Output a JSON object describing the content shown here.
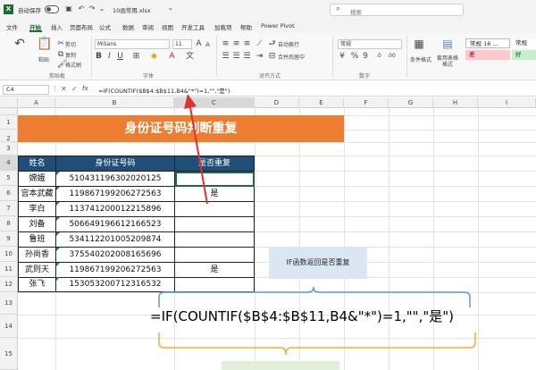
{
  "titlebar": {
    "autosave_label": "自动保存",
    "toggle_state": "关",
    "filename": "10函常用.xlsx",
    "search_placeholder": "搜索"
  },
  "menu": [
    "文件",
    "开始",
    "插入",
    "页面布局",
    "公式",
    "数据",
    "审阅",
    "视图",
    "开发工具",
    "加载项",
    "帮助",
    "Power Pivot"
  ],
  "ribbon": {
    "clipboard": {
      "paste": "粘贴",
      "cut": "剪切",
      "copy": "复制",
      "format_painter": "格式刷",
      "group": "剪贴板"
    },
    "font": {
      "name": "MiSans",
      "size": "11",
      "group": "字体"
    },
    "alignment": {
      "wrap": "自动换行",
      "merge": "合并后居中",
      "group": "对齐方式"
    },
    "number": {
      "format": "常规",
      "group": "数字"
    },
    "styles": {
      "conditional": "条件格式",
      "table_format": "套用表格格式",
      "style_normal": "常规 16 ...",
      "style_normal2": "常规",
      "style_bad": "差",
      "style_good": "好"
    }
  },
  "formula_bar": {
    "namebox": "C4",
    "fx": "fx",
    "formula": "=IF(COUNTIF($B$4:$B$11,B4&\"*\")=1,\"\",\"是\")"
  },
  "sheet": {
    "columns": [
      "A",
      "B",
      "C",
      "D",
      "E",
      "F",
      "G",
      "H",
      "I"
    ],
    "rows": [
      "1",
      "2",
      "3",
      "4",
      "5",
      "6",
      "7",
      "8",
      "9",
      "10",
      "11",
      "12",
      "13",
      "14",
      "15"
    ],
    "banner": "身份证号码判断重复",
    "headers": [
      "姓名",
      "身份证号码",
      "是否重复"
    ],
    "table": [
      [
        "嫦娥",
        "510431196302020125",
        ""
      ],
      [
        "宫本武藏",
        "119867199206272563",
        "是"
      ],
      [
        "李白",
        "113741200012215896",
        ""
      ],
      [
        "刘备",
        "506649196612166523",
        ""
      ],
      [
        "鲁班",
        "534112201005209874",
        ""
      ],
      [
        "孙尚香",
        "375540202008165696",
        ""
      ],
      [
        "武则天",
        "119867199206272563",
        "是"
      ],
      [
        "张飞",
        "153053200712316532",
        ""
      ]
    ]
  },
  "annotation": {
    "note": "IF函数返回是否重复",
    "formula_large": "=IF(COUNTIF($B$4:$B$11,B4&\"*\")=1,\"\",\"是\")"
  },
  "colors": {
    "banner": "#ed7d31",
    "header": "#1f4e78",
    "arrow": "#e03030",
    "brace_blue": "#5b9bd5",
    "brace_orange": "#f0b030",
    "accent_green": "#1e6b3a"
  }
}
